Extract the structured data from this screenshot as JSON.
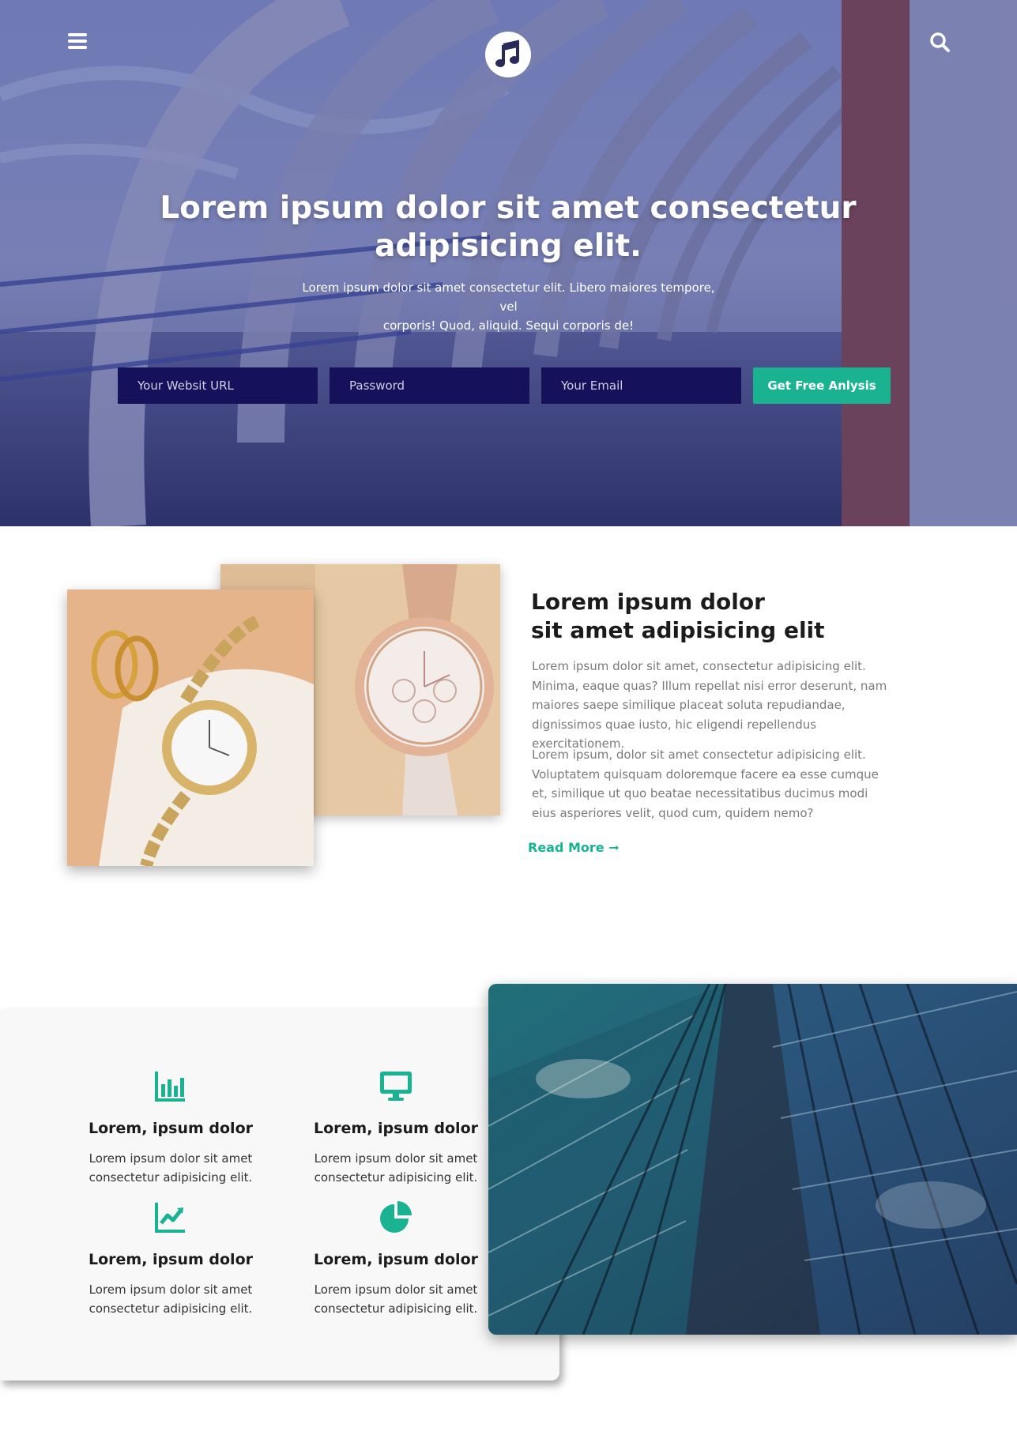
{
  "hero": {
    "title_line1": "Lorem ipsum dolor sit amet consectetur",
    "title_line2": "adipisicing elit.",
    "subtitle_line1": "Lorem ipsum dolor sit amet consectetur elit. Libero maiores tempore, vel",
    "subtitle_line2": "corporis! Quod, aliquid. Sequi corporis de!",
    "form": {
      "url_placeholder": "Your Websit URL",
      "password_placeholder": "Password",
      "email_placeholder": "Your Email",
      "submit_label": "Get Free Anlysis"
    }
  },
  "about": {
    "title_line1": "Lorem ipsum dolor",
    "title_line2": "sit amet adipisicing elit",
    "paragraph1": "Lorem ipsum dolor sit amet, consectetur adipisicing elit. Minima, eaque quas? Illum repellat nisi error deserunt, nam maiores saepe similique placeat soluta repudiandae, dignissimos quae iusto, hic eligendi repellendus exercitationem.",
    "paragraph2": "Lorem ipsum, dolor sit amet consectetur adipisicing elit. Voluptatem quisquam doloremque facere ea esse cumque et, similique ut quo beatae necessitatibus ducimus modi eius asperiores velit, quod cum, quidem nemo?",
    "read_more": "Read More ➞"
  },
  "features": [
    {
      "icon": "bar-chart-icon",
      "title": "Lorem, ipsum dolor",
      "text": "Lorem ipsum dolor sit amet consectetur adipisicing elit."
    },
    {
      "icon": "desktop-icon",
      "title": "Lorem, ipsum dolor",
      "text": "Lorem ipsum dolor sit amet consectetur adipisicing elit."
    },
    {
      "icon": "line-chart-icon",
      "title": "Lorem, ipsum dolor",
      "text": "Lorem ipsum dolor sit amet consectetur adipisicing elit."
    },
    {
      "icon": "pie-chart-icon",
      "title": "Lorem, ipsum dolor",
      "text": "Lorem ipsum dolor sit amet consectetur adipisicing elit."
    }
  ],
  "colors": {
    "accent": "#19b391",
    "hero_input_bg": "#15115a",
    "navy": "#15115a"
  }
}
